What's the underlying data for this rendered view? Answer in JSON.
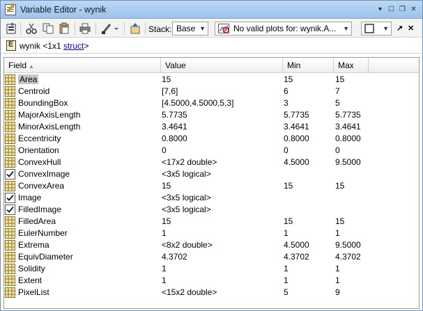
{
  "window": {
    "title": "Variable Editor - wynik"
  },
  "title_controls": [
    "▾",
    "☐",
    "❐",
    "✕"
  ],
  "toolbar": {
    "stack_label": "Stack:",
    "stack_value": "Base",
    "plots_value": "No valid plots for: wynik.A...",
    "undock_symbol": "↗",
    "close_symbol": "✕"
  },
  "breadcrumb": {
    "var": "wynik <1x1 ",
    "type_link": "struct",
    "close": ">"
  },
  "columns": {
    "field": "Field",
    "value": "Value",
    "min": "Min",
    "max": "Max"
  },
  "rows": [
    {
      "icon": "numeric-grid-icon",
      "field": "Area",
      "value": "15",
      "min": "15",
      "max": "15"
    },
    {
      "icon": "numeric-grid-icon",
      "field": "Centroid",
      "value": "[7,6]",
      "min": "6",
      "max": "7"
    },
    {
      "icon": "numeric-grid-icon",
      "field": "BoundingBox",
      "value": "[4.5000,4.5000,5,3]",
      "min": "3",
      "max": "5"
    },
    {
      "icon": "numeric-grid-icon",
      "field": "MajorAxisLength",
      "value": "5.7735",
      "min": "5.7735",
      "max": "5.7735"
    },
    {
      "icon": "numeric-grid-icon",
      "field": "MinorAxisLength",
      "value": "3.4641",
      "min": "3.4641",
      "max": "3.4641"
    },
    {
      "icon": "numeric-grid-icon",
      "field": "Eccentricity",
      "value": "0.8000",
      "min": "0.8000",
      "max": "0.8000"
    },
    {
      "icon": "numeric-grid-icon",
      "field": "Orientation",
      "value": "0",
      "min": "0",
      "max": "0"
    },
    {
      "icon": "numeric-grid-icon",
      "field": "ConvexHull",
      "value": "<17x2 double>",
      "min": "4.5000",
      "max": "9.5000"
    },
    {
      "icon": "logical-check-icon",
      "field": "ConvexImage",
      "value": "<3x5 logical>",
      "min": "",
      "max": ""
    },
    {
      "icon": "numeric-grid-icon",
      "field": "ConvexArea",
      "value": "15",
      "min": "15",
      "max": "15"
    },
    {
      "icon": "logical-check-icon",
      "field": "Image",
      "value": "<3x5 logical>",
      "min": "",
      "max": ""
    },
    {
      "icon": "logical-check-icon",
      "field": "FilledImage",
      "value": "<3x5 logical>",
      "min": "",
      "max": ""
    },
    {
      "icon": "numeric-grid-icon",
      "field": "FilledArea",
      "value": "15",
      "min": "15",
      "max": "15"
    },
    {
      "icon": "numeric-grid-icon",
      "field": "EulerNumber",
      "value": "1",
      "min": "1",
      "max": "1"
    },
    {
      "icon": "numeric-grid-icon",
      "field": "Extrema",
      "value": "<8x2 double>",
      "min": "4.5000",
      "max": "9.5000"
    },
    {
      "icon": "numeric-grid-icon",
      "field": "EquivDiameter",
      "value": "4.3702",
      "min": "4.3702",
      "max": "4.3702"
    },
    {
      "icon": "numeric-grid-icon",
      "field": "Solidity",
      "value": "1",
      "min": "1",
      "max": "1"
    },
    {
      "icon": "numeric-grid-icon",
      "field": "Extent",
      "value": "1",
      "min": "1",
      "max": "1"
    },
    {
      "icon": "numeric-grid-icon",
      "field": "PixelList",
      "value": "<15x2 double>",
      "min": "5",
      "max": "9"
    }
  ],
  "colors": {
    "title_bar": "#bcd8f4",
    "selection": "#c7c7c7",
    "link": "#0000cc"
  }
}
